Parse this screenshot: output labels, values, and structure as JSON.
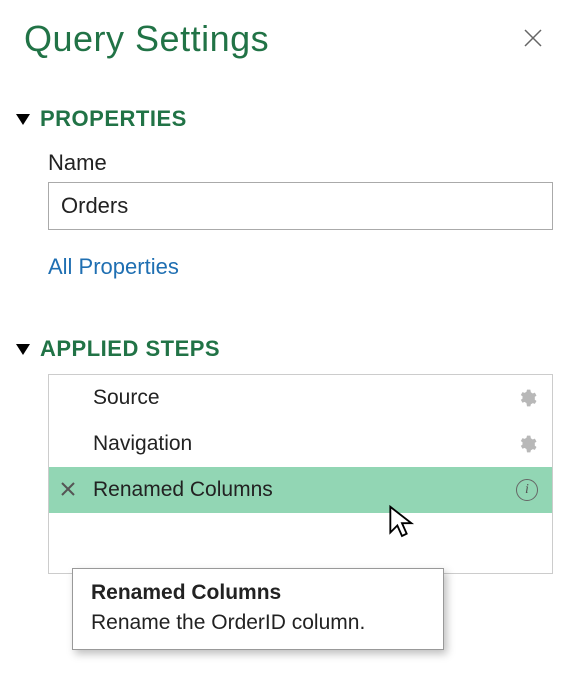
{
  "panel": {
    "title": "Query Settings"
  },
  "properties": {
    "section_label": "PROPERTIES",
    "name_label": "Name",
    "name_value": "Orders",
    "all_properties_link": "All Properties"
  },
  "applied_steps": {
    "section_label": "APPLIED STEPS",
    "items": [
      {
        "label": "Source",
        "has_settings": true,
        "selected": false
      },
      {
        "label": "Navigation",
        "has_settings": true,
        "selected": false
      },
      {
        "label": "Renamed Columns",
        "has_settings": false,
        "selected": true,
        "has_info": true,
        "can_delete": true
      }
    ]
  },
  "tooltip": {
    "title": "Renamed Columns",
    "description": "Rename the OrderID column."
  }
}
